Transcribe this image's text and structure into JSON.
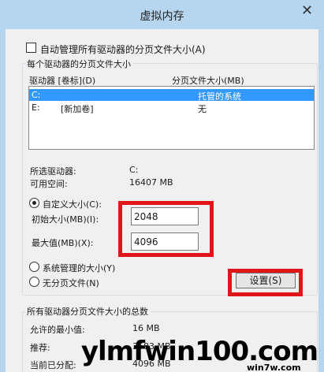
{
  "window": {
    "title": "虚拟内存",
    "close_glyph": "✕"
  },
  "auto_manage": {
    "label": "自动管理所有驱动器的分页文件大小(A)",
    "checked": false
  },
  "group_per_drive": {
    "label": "每个驱动器的分页文件大小",
    "col_drive": "驱动器 [卷标](D)",
    "col_size": "分页文件大小(MB)",
    "drives": [
      {
        "drive": "C:",
        "label": "",
        "size": "托管的系统",
        "selected": true
      },
      {
        "drive": "E:",
        "label": "[新加卷]",
        "size": "无",
        "selected": false
      }
    ],
    "selected_drive_label": "所选驱动器:",
    "selected_drive_value": "C:",
    "free_space_label": "可用空间:",
    "free_space_value": "16407 MB",
    "custom_size_label": "自定义大小(C):",
    "initial_size_label": "初始大小(MB)(I):",
    "initial_size_value": "2048",
    "max_size_label": "最大值(MB)(X):",
    "max_size_value": "4096",
    "system_managed_label": "系统管理的大小(Y)",
    "no_paging_label": "无分页文件(N)",
    "set_button": "设置(S)"
  },
  "group_total": {
    "label": "所有驱动器分页文件大小的总数",
    "min_allowed_label": "允许的最小值:",
    "min_allowed_value": "16 MB",
    "recommended_label": "推荐:",
    "recommended_value": "3583 MB",
    "allocated_label": "当前已分配:",
    "allocated_value": "4096 MB"
  },
  "watermark": {
    "main": "ylmfwin100.com",
    "sub": "win7w.com"
  },
  "colors": {
    "highlight_box": "#e2151b",
    "selection": "#3399ff",
    "titlebar": "#b6d5ee"
  }
}
